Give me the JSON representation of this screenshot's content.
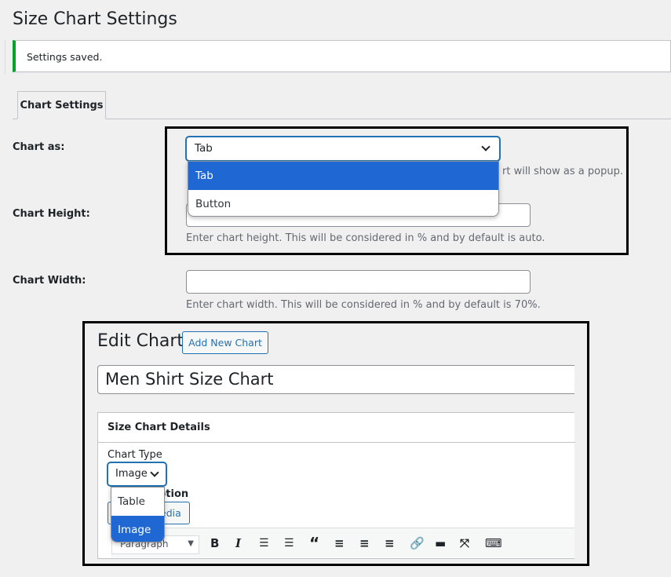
{
  "page": {
    "title": "Size Chart Settings"
  },
  "notice": {
    "text": "Settings saved."
  },
  "tabs": [
    {
      "label": "Chart Settings"
    }
  ],
  "settings": {
    "chart_as": {
      "label": "Chart as:",
      "value": "Tab",
      "description_tail": "rt will show as a popup.",
      "options": [
        "Tab",
        "Button"
      ],
      "selected": "Tab"
    },
    "chart_height": {
      "label": "Chart Height:",
      "value": "",
      "description": "Enter chart height. This will be considered in % and by default is auto."
    },
    "chart_width": {
      "label": "Chart Width:",
      "value": "",
      "description": "Enter chart width. This will be considered in % and by default is 70%."
    }
  },
  "edit": {
    "heading": "Edit Chart",
    "add_new_label": "Add New Chart",
    "title_value": "Men Shirt Size Chart",
    "metabox": {
      "title": "Size Chart Details",
      "chart_type_label": "Chart Type",
      "chart_type_value": "Image",
      "chart_type_options": [
        "Table",
        "Image"
      ],
      "chart_type_selected": "Image",
      "caption_label_tail": "ption",
      "media_button_tail": "edia",
      "editor_format": "Paragraph"
    }
  },
  "colors": {
    "notice_border": "#00a32a",
    "accent": "#2271b1",
    "selection": "#1f67d2"
  },
  "toolbar_icons": [
    "bold-icon",
    "italic-icon",
    "bullet-list-icon",
    "numbered-list-icon",
    "blockquote-icon",
    "align-left-icon",
    "align-center-icon",
    "align-right-icon",
    "link-icon",
    "read-more-icon",
    "fullscreen-icon",
    "keyboard-icon"
  ]
}
